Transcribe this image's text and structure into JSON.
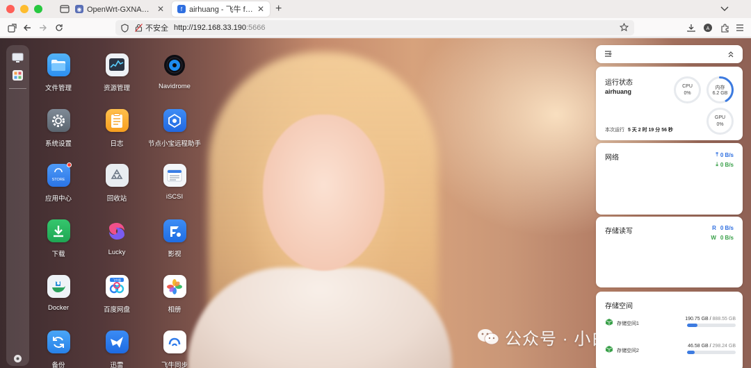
{
  "browser": {
    "tabs": [
      {
        "title": "OpenWrt-GXNAS - 概览 - LuCI",
        "active": false
      },
      {
        "title": "airhuang - 飞牛 fnOS",
        "active": true
      }
    ],
    "url": {
      "insecure_label": "不安全",
      "scheme_host": "http://192.168.33.190",
      "port": ":5666"
    }
  },
  "desktop": {
    "apps": [
      {
        "label": "文件管理",
        "icon": "folder-icon"
      },
      {
        "label": "资源管理",
        "icon": "monitor-chart-icon"
      },
      {
        "label": "Navidrome",
        "icon": "vinyl-icon"
      },
      {
        "label": "系统设置",
        "icon": "gear-icon"
      },
      {
        "label": "日志",
        "icon": "log-icon"
      },
      {
        "label": "节点小宝远程助手",
        "icon": "remote-helper-icon"
      },
      {
        "label": "应用中心",
        "icon": "store-icon",
        "store_text": "STORE"
      },
      {
        "label": "回收站",
        "icon": "recycle-icon"
      },
      {
        "label": "iSCSI",
        "icon": "iscsi-icon"
      },
      {
        "label": "下载",
        "icon": "download-icon"
      },
      {
        "label": "Lucky",
        "icon": "lucky-icon"
      },
      {
        "label": "影视",
        "icon": "video-icon"
      },
      {
        "label": "Docker",
        "icon": "docker-icon"
      },
      {
        "label": "百度网盘",
        "icon": "baidu-cloud-icon",
        "ribbon_text": "飞牛版"
      },
      {
        "label": "相册",
        "icon": "photos-icon"
      },
      {
        "label": "备份",
        "icon": "backup-icon"
      },
      {
        "label": "迅雷",
        "icon": "thunder-icon"
      },
      {
        "label": "飞牛同步",
        "icon": "sync-icon"
      }
    ]
  },
  "widgets": {
    "status": {
      "title": "运行状态",
      "hostname": "airhuang",
      "uptime_prefix": "本次运行",
      "uptime": "5 天 2 时 19 分 56 秒",
      "cpu_label": "CPU",
      "cpu_value": "0%",
      "cpu_fraction": 0.0,
      "mem_label": "内存",
      "mem_value": "6.2 GB",
      "mem_fraction": 0.42,
      "gpu_label": "GPU",
      "gpu_value": "0%",
      "gpu_fraction": 0.0
    },
    "network": {
      "title": "网络",
      "upload": "0 B/s",
      "download": "0 B/s"
    },
    "disk_io": {
      "title": "存储读写",
      "read_label": "R",
      "read": "0 B/s",
      "write_label": "W",
      "write": "0 B/s"
    },
    "storage": {
      "title": "存储空间",
      "pools": [
        {
          "name": "存储空间1",
          "used": "190.75 GB",
          "total": "888.55 GB",
          "fraction": 0.215
        },
        {
          "name": "存储空间2",
          "used": "46.58 GB",
          "total": "298.24 GB",
          "fraction": 0.156
        }
      ]
    }
  },
  "watermark": {
    "text": "公众号 · 小白电脑技术"
  },
  "colors": {
    "accent": "#3d7be0",
    "upload": "#2f6fe0",
    "download": "#3aa04a"
  }
}
